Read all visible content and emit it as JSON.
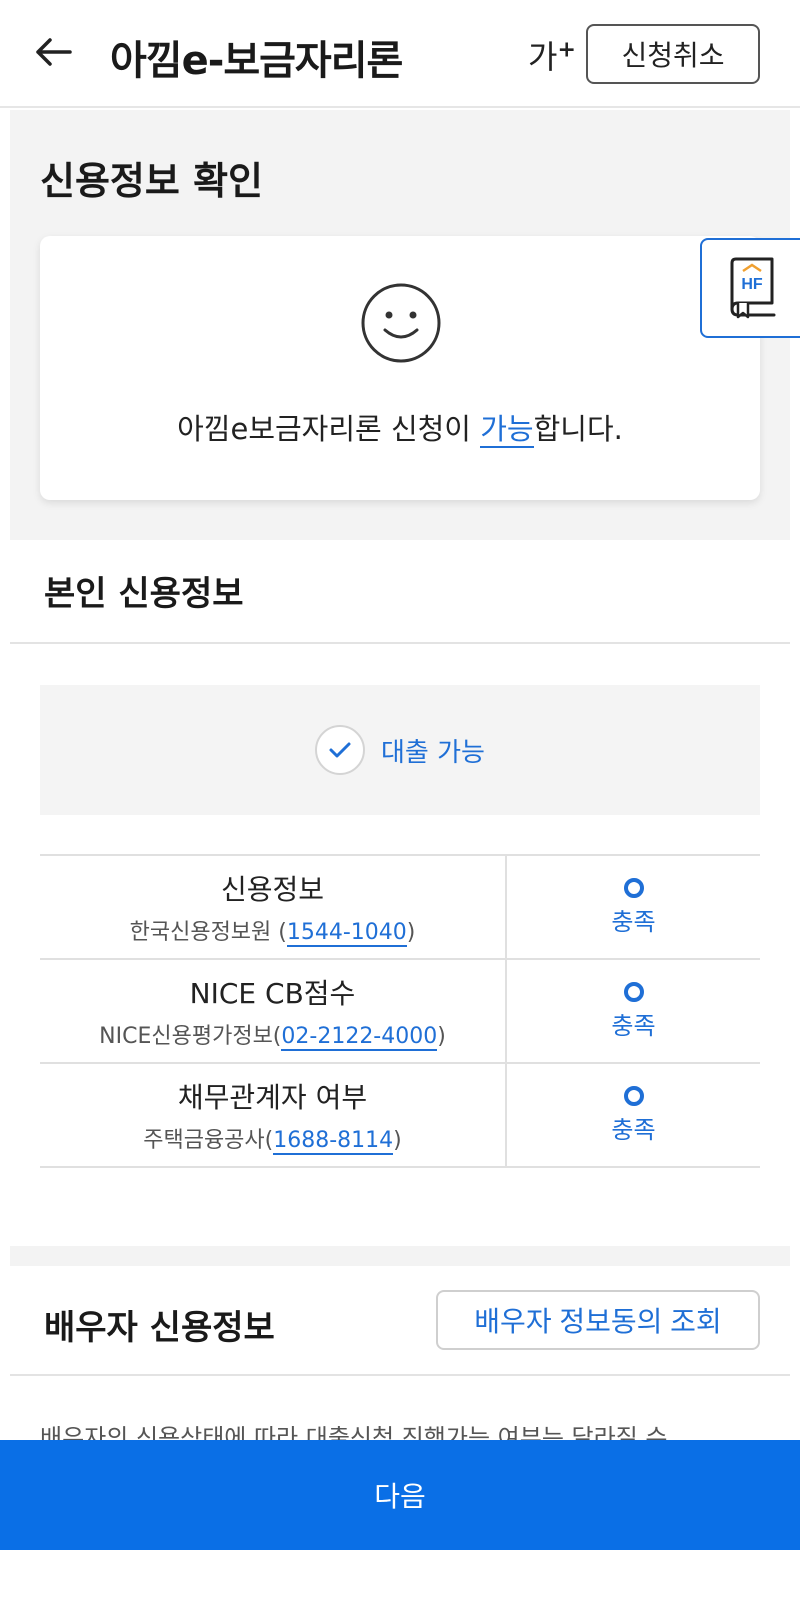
{
  "header": {
    "title": "아낌e-보금자리론",
    "font_size_label": "가",
    "font_size_sup": "+",
    "cancel_label": "신청취소"
  },
  "credit_check": {
    "title": "신용정보 확인",
    "result_prefix": "아낌e보금자리론 신청이 ",
    "result_highlight": "가능",
    "result_suffix": "합니다."
  },
  "guide_tab": {
    "logo_text": "HF"
  },
  "self_credit": {
    "title": "본인 신용정보",
    "status_label": "대출 가능",
    "rows": [
      {
        "name": "신용정보",
        "source_prefix": "한국신용정보원 (",
        "phone": "1544-1040",
        "source_suffix": ")",
        "result": "충족"
      },
      {
        "name": "NICE CB점수",
        "source_prefix": "NICE신용평가정보(",
        "phone": "02-2122-4000",
        "source_suffix": ")",
        "result": "충족"
      },
      {
        "name": "채무관계자 여부",
        "source_prefix": "주택금융공사(",
        "phone": "1688-8114",
        "source_suffix": ")",
        "result": "충족"
      }
    ]
  },
  "spouse_credit": {
    "title": "배우자 신용정보",
    "inquiry_button": "배우자 정보동의 조회",
    "notice": "배우자의 신용상태에 따라 대출신청 진행가능 여부는 달라질 수"
  },
  "footer": {
    "next_label": "다음"
  },
  "colors": {
    "accent": "#1f6fd6",
    "primary_button": "#0a6fe6",
    "highlight_mark": "#c6e3fb"
  }
}
